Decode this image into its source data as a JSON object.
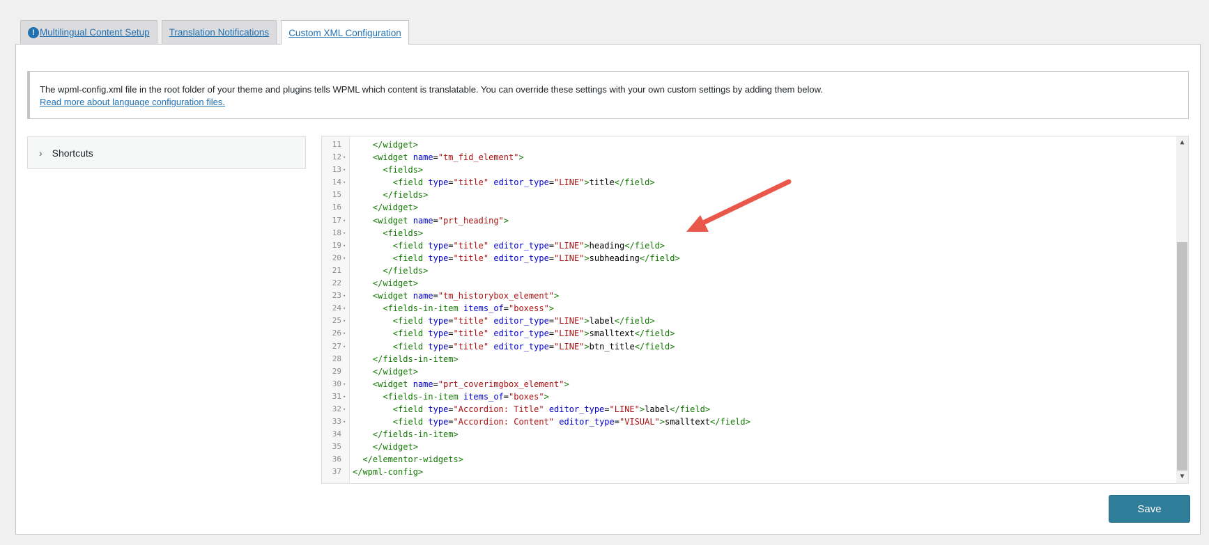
{
  "tabs": [
    {
      "label": "Multilingual Content Setup",
      "badge": "!"
    },
    {
      "label": "Translation Notifications"
    },
    {
      "label": "Custom XML Configuration"
    }
  ],
  "notice": {
    "text": "The wpml-config.xml file in the root folder of your theme and plugins tells WPML which content is translatable. You can override these settings with your own custom settings by adding them below.",
    "link": "Read more about language configuration files."
  },
  "shortcuts": {
    "label": "Shortcuts",
    "icon": "chevron-right-icon"
  },
  "editor": {
    "lines": [
      {
        "n": "11",
        "fold": false,
        "html": "    <span class='t'>&lt;/widget&gt;</span>"
      },
      {
        "n": "12",
        "fold": true,
        "html": "    <span class='t'>&lt;widget</span> <span class='a'>name</span>=<span class='s'>\"tm_fid_element\"</span><span class='t'>&gt;</span>"
      },
      {
        "n": "13",
        "fold": true,
        "html": "      <span class='t'>&lt;fields&gt;</span>"
      },
      {
        "n": "14",
        "fold": true,
        "html": "        <span class='t'>&lt;field</span> <span class='a'>type</span>=<span class='s'>\"title\"</span> <span class='a'>editor_type</span>=<span class='s'>\"LINE\"</span><span class='t'>&gt;</span>title<span class='t'>&lt;/field&gt;</span>"
      },
      {
        "n": "15",
        "fold": false,
        "html": "      <span class='t'>&lt;/fields&gt;</span>"
      },
      {
        "n": "16",
        "fold": false,
        "html": "    <span class='t'>&lt;/widget&gt;</span>"
      },
      {
        "n": "17",
        "fold": true,
        "html": "    <span class='t'>&lt;widget</span> <span class='a'>name</span>=<span class='s'>\"prt_heading\"</span><span class='t'>&gt;</span>"
      },
      {
        "n": "18",
        "fold": true,
        "html": "      <span class='t'>&lt;fields&gt;</span>"
      },
      {
        "n": "19",
        "fold": true,
        "html": "        <span class='t'>&lt;field</span> <span class='a'>type</span>=<span class='s'>\"title\"</span> <span class='a'>editor_type</span>=<span class='s'>\"LINE\"</span><span class='t'>&gt;</span>heading<span class='t'>&lt;/field&gt;</span>"
      },
      {
        "n": "20",
        "fold": true,
        "html": "        <span class='t'>&lt;field</span> <span class='a'>type</span>=<span class='s'>\"title\"</span> <span class='a'>editor_type</span>=<span class='s'>\"LINE\"</span><span class='t'>&gt;</span>subheading<span class='t'>&lt;/field&gt;</span>"
      },
      {
        "n": "21",
        "fold": false,
        "html": "      <span class='t'>&lt;/fields&gt;</span>"
      },
      {
        "n": "22",
        "fold": false,
        "html": "    <span class='t'>&lt;/widget&gt;</span>"
      },
      {
        "n": "23",
        "fold": true,
        "html": "    <span class='t'>&lt;widget</span> <span class='a'>name</span>=<span class='s'>\"tm_historybox_element\"</span><span class='t'>&gt;</span>"
      },
      {
        "n": "24",
        "fold": true,
        "html": "      <span class='t'>&lt;fields-in-item</span> <span class='a'>items_of</span>=<span class='s'>\"boxess\"</span><span class='t'>&gt;</span>"
      },
      {
        "n": "25",
        "fold": true,
        "html": "        <span class='t'>&lt;field</span> <span class='a'>type</span>=<span class='s'>\"title\"</span> <span class='a'>editor_type</span>=<span class='s'>\"LINE\"</span><span class='t'>&gt;</span>label<span class='t'>&lt;/field&gt;</span>"
      },
      {
        "n": "26",
        "fold": true,
        "html": "        <span class='t'>&lt;field</span> <span class='a'>type</span>=<span class='s'>\"title\"</span> <span class='a'>editor_type</span>=<span class='s'>\"LINE\"</span><span class='t'>&gt;</span>smalltext<span class='t'>&lt;/field&gt;</span>"
      },
      {
        "n": "27",
        "fold": true,
        "html": "        <span class='t'>&lt;field</span> <span class='a'>type</span>=<span class='s'>\"title\"</span> <span class='a'>editor_type</span>=<span class='s'>\"LINE\"</span><span class='t'>&gt;</span>btn_title<span class='t'>&lt;/field&gt;</span>"
      },
      {
        "n": "28",
        "fold": false,
        "html": "    <span class='t'>&lt;/fields-in-item&gt;</span>"
      },
      {
        "n": "29",
        "fold": false,
        "html": "    <span class='t'>&lt;/widget&gt;</span>"
      },
      {
        "n": "30",
        "fold": true,
        "html": "    <span class='t'>&lt;widget</span> <span class='a'>name</span>=<span class='s'>\"prt_coverimgbox_element\"</span><span class='t'>&gt;</span>"
      },
      {
        "n": "31",
        "fold": true,
        "html": "      <span class='t'>&lt;fields-in-item</span> <span class='a'>items_of</span>=<span class='s'>\"boxes\"</span><span class='t'>&gt;</span>"
      },
      {
        "n": "32",
        "fold": true,
        "html": "        <span class='t'>&lt;field</span> <span class='a'>type</span>=<span class='s'>\"Accordion: Title\"</span> <span class='a'>editor_type</span>=<span class='s'>\"LINE\"</span><span class='t'>&gt;</span>label<span class='t'>&lt;/field&gt;</span>"
      },
      {
        "n": "33",
        "fold": true,
        "html": "        <span class='t'>&lt;field</span> <span class='a'>type</span>=<span class='s'>\"Accordion: Content\"</span> <span class='a'>editor_type</span>=<span class='s'>\"VISUAL\"</span><span class='t'>&gt;</span>smalltext<span class='t'>&lt;/field&gt;</span>"
      },
      {
        "n": "34",
        "fold": false,
        "html": "    <span class='t'>&lt;/fields-in-item&gt;</span>"
      },
      {
        "n": "35",
        "fold": false,
        "html": "    <span class='t'>&lt;/widget&gt;</span>"
      },
      {
        "n": "36",
        "fold": false,
        "html": "  <span class='t'>&lt;/elementor-widgets&gt;</span>"
      },
      {
        "n": "37",
        "fold": false,
        "html": "<span class='t'>&lt;/wpml-config&gt;</span>"
      }
    ]
  },
  "save_label": "Save",
  "colors": {
    "accent": "#2271b1",
    "button": "#2e7d99",
    "arrow": "#e8574a"
  }
}
